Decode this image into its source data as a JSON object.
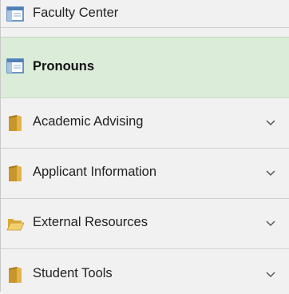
{
  "menu": {
    "items": [
      {
        "label": "Faculty Center",
        "icon": "window-icon",
        "selected": false,
        "expandable": false
      },
      {
        "label": "Pronouns",
        "icon": "window-icon",
        "selected": true,
        "expandable": false
      },
      {
        "label": "Academic Advising",
        "icon": "folder-closed-icon",
        "selected": false,
        "expandable": true
      },
      {
        "label": "Applicant Information",
        "icon": "folder-closed-icon",
        "selected": false,
        "expandable": true
      },
      {
        "label": "External Resources",
        "icon": "folder-open-icon",
        "selected": false,
        "expandable": true
      },
      {
        "label": "Student Tools",
        "icon": "folder-closed-icon",
        "selected": false,
        "expandable": true
      }
    ]
  },
  "colors": {
    "selected_background": "#dbecd9",
    "background": "#f2f1f2",
    "window_icon_blue": "#4f7fb6",
    "folder_gold": "#c8962b"
  }
}
